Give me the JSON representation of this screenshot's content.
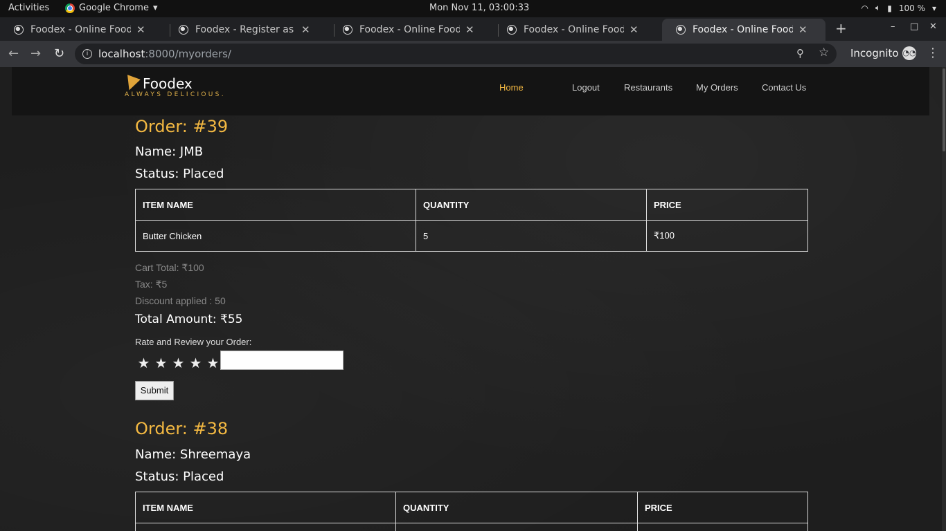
{
  "gnome": {
    "activities": "Activities",
    "app_name": "Google Chrome",
    "clock": "Mon Nov 11, 03:00:33",
    "battery": "100 %"
  },
  "tabs": [
    {
      "label": "Foodex - Online Food Del"
    },
    {
      "label": "Foodex - Register as a Cus"
    },
    {
      "label": "Foodex - Online Food Del"
    },
    {
      "label": "Foodex - Online Food Del"
    },
    {
      "label": "Foodex - Online Food Del"
    }
  ],
  "omnibox": {
    "host": "localhost",
    "path": ":8000/myorders/"
  },
  "incognito_label": "Incognito",
  "site": {
    "brand": "Foodex",
    "tagline": "ALWAYS DELICIOUS.",
    "nav": [
      "Home",
      "Logout",
      "Restaurants",
      "My Orders",
      "Contact Us"
    ]
  },
  "table_headers": [
    "ITEM NAME",
    "QUANTITY",
    "PRICE"
  ],
  "orders": [
    {
      "title": "Order: #39",
      "name": "Name: JMB",
      "status": "Status: Placed",
      "rows": [
        [
          "Butter Chicken",
          "5",
          "₹100"
        ]
      ],
      "cart_total": "Cart Total: ₹100",
      "tax": "Tax: ₹5",
      "discount": "Discount applied : 50",
      "total": "Total Amount: ₹55",
      "rate_label": "Rate and Review your Order:",
      "submit": "Submit"
    },
    {
      "title": "Order: #38",
      "name": "Name: Shreemaya",
      "status": "Status: Placed"
    }
  ],
  "colors": {
    "accent": "#f4b942",
    "page_bg": "#1e1e1e",
    "header_bg": "#141414"
  }
}
